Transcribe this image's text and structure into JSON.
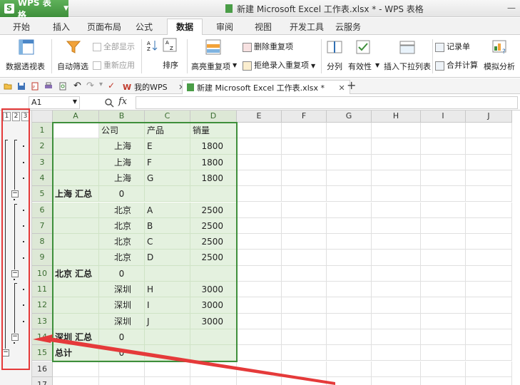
{
  "app": {
    "name": "WPS 表格",
    "logo": "S"
  },
  "window": {
    "title": "新建 Microsoft Excel 工作表.xlsx * - WPS 表格"
  },
  "ribbon": {
    "tabs": [
      "开始",
      "插入",
      "页面布局",
      "公式",
      "数据",
      "审阅",
      "视图",
      "开发工具",
      "云服务"
    ],
    "active_tab": "数据",
    "buttons": {
      "pivot": "数据透视表",
      "autofilter": "自动筛选",
      "show_all": "全部显示",
      "reapply": "重新应用",
      "sort": "排序",
      "highlight_dup": "高亮重复项",
      "delete_dup": "删除重复项",
      "reject_dup": "拒绝录入重复项",
      "split": "分列",
      "validity": "有效性",
      "dropdown": "插入下拉列表",
      "record": "记录单",
      "merge_calc": "合并计算",
      "simulate": "模拟分析"
    }
  },
  "doc_tabs": {
    "mywps": "我的WPS",
    "current": "新建 Microsoft Excel 工作表.xlsx *"
  },
  "formula_bar": {
    "name_box": "A1",
    "fx": "fx"
  },
  "outline": {
    "levels": [
      "1",
      "2",
      "3"
    ]
  },
  "sheet": {
    "columns": [
      "A",
      "B",
      "C",
      "D",
      "E",
      "F",
      "G",
      "H",
      "I",
      "J"
    ],
    "rows": [
      {
        "n": "1",
        "a": "",
        "b": "公司",
        "c": "产品",
        "d": "销量"
      },
      {
        "n": "2",
        "a": "",
        "b": "上海",
        "c": "E",
        "d": "1800"
      },
      {
        "n": "3",
        "a": "",
        "b": "上海",
        "c": "F",
        "d": "1800"
      },
      {
        "n": "4",
        "a": "",
        "b": "上海",
        "c": "G",
        "d": "1800"
      },
      {
        "n": "5",
        "a": "上海 汇总",
        "b": "0",
        "c": "",
        "d": ""
      },
      {
        "n": "6",
        "a": "",
        "b": "北京",
        "c": "A",
        "d": "2500"
      },
      {
        "n": "7",
        "a": "",
        "b": "北京",
        "c": "B",
        "d": "2500"
      },
      {
        "n": "8",
        "a": "",
        "b": "北京",
        "c": "C",
        "d": "2500"
      },
      {
        "n": "9",
        "a": "",
        "b": "北京",
        "c": "D",
        "d": "2500"
      },
      {
        "n": "10",
        "a": "北京 汇总",
        "b": "0",
        "c": "",
        "d": ""
      },
      {
        "n": "11",
        "a": "",
        "b": "深圳",
        "c": "H",
        "d": "3000"
      },
      {
        "n": "12",
        "a": "",
        "b": "深圳",
        "c": "I",
        "d": "3000"
      },
      {
        "n": "13",
        "a": "",
        "b": "深圳",
        "c": "J",
        "d": "3000"
      },
      {
        "n": "14",
        "a": "深圳 汇总",
        "b": "0",
        "c": "",
        "d": ""
      },
      {
        "n": "15",
        "a": "总计",
        "b": "0",
        "c": "",
        "d": ""
      },
      {
        "n": "16",
        "a": "",
        "b": "",
        "c": "",
        "d": ""
      },
      {
        "n": "17",
        "a": "",
        "b": "",
        "c": "",
        "d": ""
      }
    ]
  },
  "colors": {
    "accent": "#3e8f3b",
    "highlight": "#e4f1df",
    "annotation": "#e53a3a"
  }
}
